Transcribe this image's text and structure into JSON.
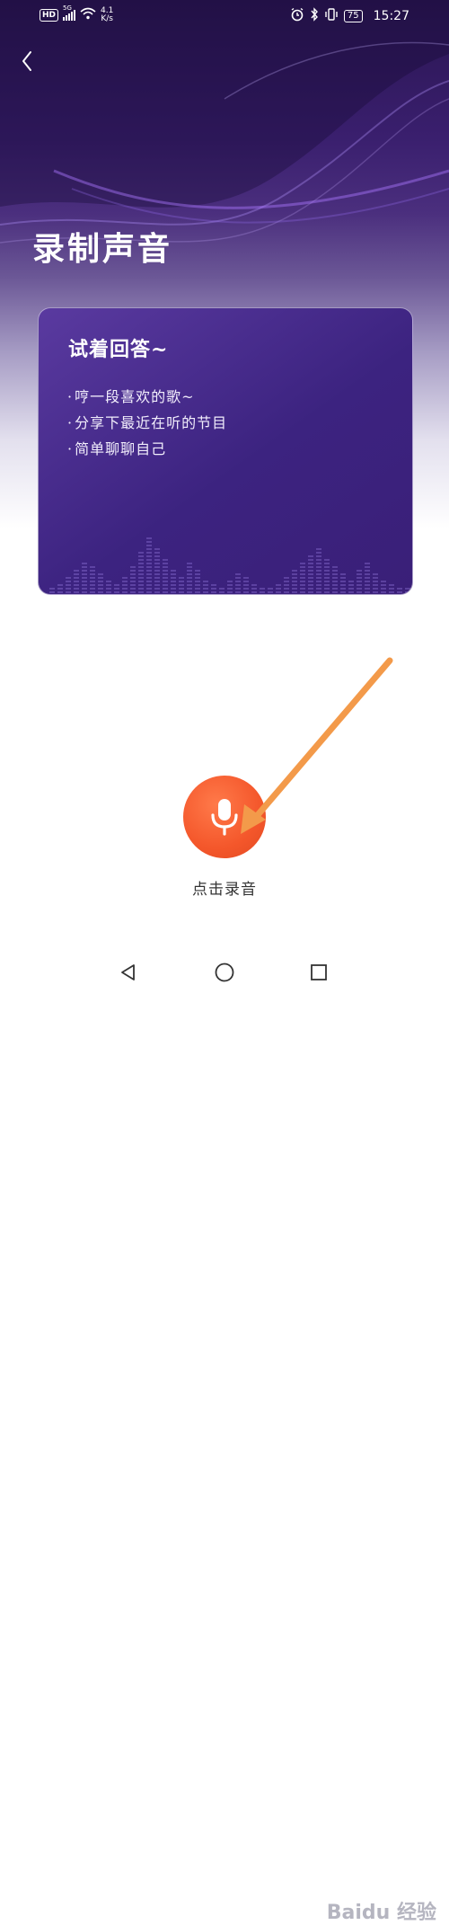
{
  "status_bar": {
    "hd": "HD",
    "signal_label": "5G",
    "net_speed_value": "4.1",
    "net_speed_unit": "K/s",
    "battery": "75",
    "time": "15:27"
  },
  "page": {
    "title": "录制声音"
  },
  "prompt_card": {
    "title": "试着回答~",
    "items": [
      "哼一段喜欢的歌~",
      "分享下最近在听的节目",
      "简单聊聊自己"
    ]
  },
  "record": {
    "label": "点击录音"
  },
  "icons": {
    "back": "chevron-left-icon",
    "mic": "microphone-icon",
    "nav_back": "triangle-back-icon",
    "nav_home": "circle-home-icon",
    "nav_recent": "square-recent-icon"
  },
  "colors": {
    "hero_top": "#2a1552",
    "card_bg": "#3c2380",
    "record_button": "#f4572b",
    "annotation_arrow": "#f39a4a"
  },
  "watermark": "Baidu 经验"
}
